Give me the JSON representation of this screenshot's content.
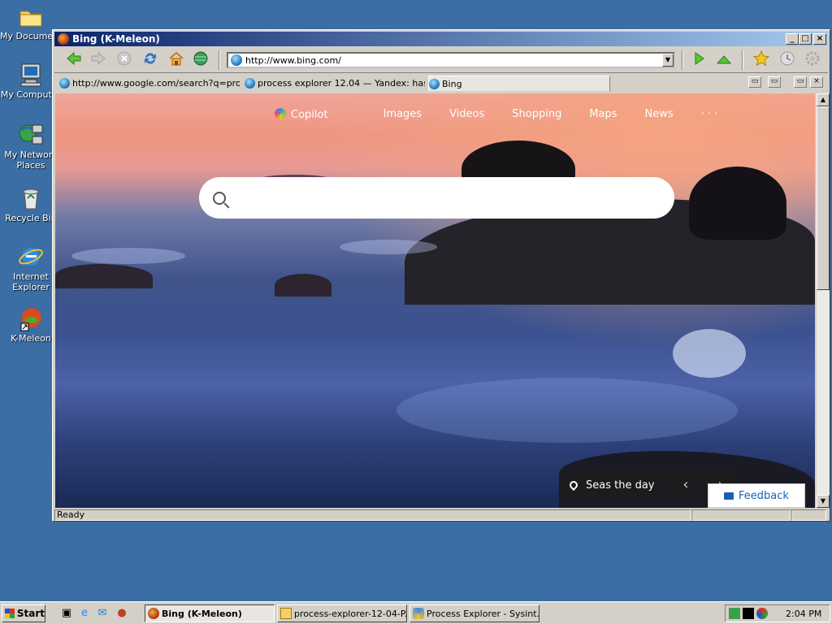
{
  "desktop": {
    "icons": [
      {
        "label": "My Documents",
        "icon": "folder-icon"
      },
      {
        "label": "My Computer",
        "icon": "computer-icon"
      },
      {
        "label": "My Network",
        "label2": "Places",
        "icon": "network-icon"
      },
      {
        "label": "Recycle Bin",
        "icon": "recycle-bin-icon"
      },
      {
        "label": "Internet",
        "label2": "Explorer",
        "icon": "ie-icon"
      },
      {
        "label": "K-Meleon",
        "icon": "kmeleon-icon"
      }
    ]
  },
  "window": {
    "title": "Bing (K-Meleon)",
    "caption_buttons": {
      "minimize": "_",
      "maximize": "□",
      "close": "×"
    }
  },
  "toolbar": {
    "url": "http://www.bing.com/",
    "buttons": [
      "back-icon",
      "forward-icon",
      "stop-icon",
      "reload-icon",
      "home-icon",
      "globe-icon",
      "go-icon",
      "up-icon",
      "bookmark-star-icon",
      "history-icon",
      "settings-icon"
    ]
  },
  "tabs": [
    {
      "label": "http://www.google.com/search?q=pro..."
    },
    {
      "label": "process explorer 12.04 — Yandex: has..."
    },
    {
      "label": "Bing",
      "active": true
    }
  ],
  "bing": {
    "nav": [
      "Copilot",
      "Images",
      "Videos",
      "Shopping",
      "Maps",
      "News",
      "· · ·"
    ],
    "search_value": "",
    "image_caption": "Seas the day",
    "prev_arrow": "‹",
    "next_arrow": "›",
    "feedback": "Feedback"
  },
  "statusbar": {
    "text": "Ready"
  },
  "taskbar": {
    "start": "Start",
    "tasks": [
      {
        "label": "Bing (K-Meleon)",
        "active": true
      },
      {
        "label": "process-explorer-12-04-P..."
      },
      {
        "label": "Process Explorer - Sysint..."
      }
    ],
    "clock": "2:04 PM"
  },
  "colors": {
    "desktop": "#3a6ea5",
    "titlebar_start": "#0a246a",
    "titlebar_end": "#a6caf0",
    "chrome": "#d4d0c8",
    "feedback_text": "#1a5fb4"
  }
}
